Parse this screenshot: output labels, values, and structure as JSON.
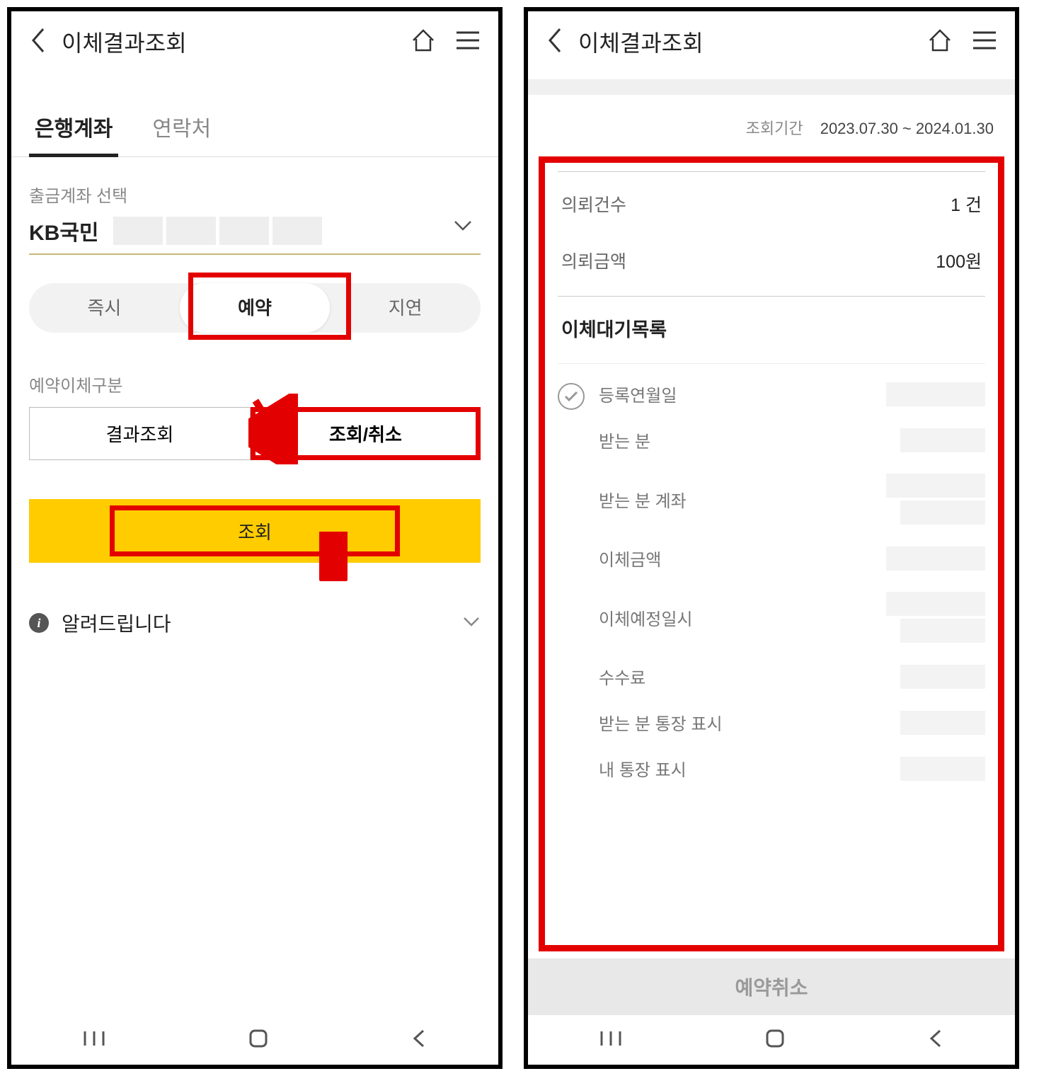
{
  "left": {
    "title": "이체결과조회",
    "tabs": {
      "bank": "은행계좌",
      "contact": "연락처"
    },
    "account_label": "출금계좌 선택",
    "bank_name": "KB국민",
    "seg": {
      "now": "즉시",
      "reserve": "예약",
      "delay": "지연"
    },
    "sub_label": "예약이체구분",
    "btn_result": "결과조회",
    "btn_cancel": "조회/취소",
    "submit": "조회",
    "notice": "알려드립니다"
  },
  "right": {
    "title": "이체결과조회",
    "period_label": "조회기간",
    "period_value": "2023.07.30 ~ 2024.01.30",
    "count_label": "의뢰건수",
    "count_value": "1 건",
    "amount_label": "의뢰금액",
    "amount_value": "100원",
    "list_title": "이체대기목록",
    "rows": {
      "reg_date": "등록연월일",
      "recipient": "받는 분",
      "recipient_acct": "받는 분 계좌",
      "amount": "이체금액",
      "sched": "이체예정일시",
      "fee": "수수료",
      "recv_memo": "받는 분 통장 표시",
      "my_memo": "내 통장 표시"
    },
    "cancel_btn": "예약취소"
  }
}
